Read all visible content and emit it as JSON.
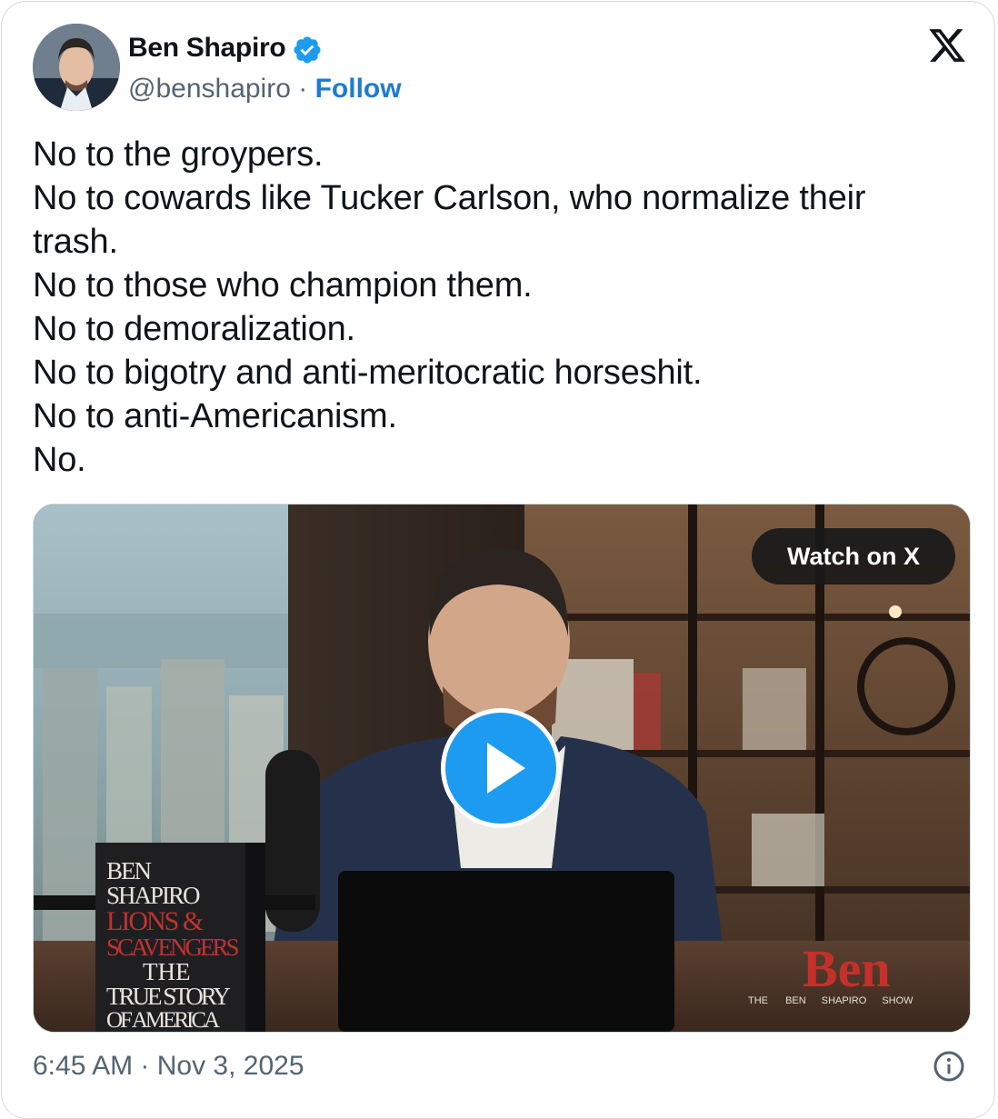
{
  "author": {
    "name": "Ben Shapiro",
    "handle": "@benshapiro",
    "separator": " · ",
    "follow_label": "Follow",
    "verified_icon": "verified-badge-icon"
  },
  "brand_icon": "x-logo-icon",
  "tweet": {
    "lines": [
      "No to the groypers.",
      "No to cowards like Tucker Carlson, who normalize their",
      "trash.",
      "No to those who champion them.",
      "No to demoralization.",
      "No to bigotry and anti-meritocratic horseshit.",
      "No to anti-Americanism.",
      "No."
    ]
  },
  "media": {
    "watch_label": "Watch on X",
    "play_icon": "play-icon",
    "book": {
      "author": "BEN SHAPIRO",
      "title_line1": "LIONS",
      "title_amp": "&",
      "title_line2": "SCAVENGERS",
      "sub_line1": "THE",
      "sub_line2": "TRUE STORY",
      "sub_line3": "OF AMERICA"
    },
    "show_logo": {
      "big": "Ben",
      "words": [
        "THE",
        "BEN",
        "SHAPIRO",
        "SHOW"
      ]
    }
  },
  "footer": {
    "timestamp": "6:45 AM · Nov 3, 2025",
    "info_icon": "info-icon"
  },
  "colors": {
    "accent": "#1d9bf0",
    "follow": "#1d7bd3",
    "muted": "#536471",
    "text": "#0f1419"
  }
}
